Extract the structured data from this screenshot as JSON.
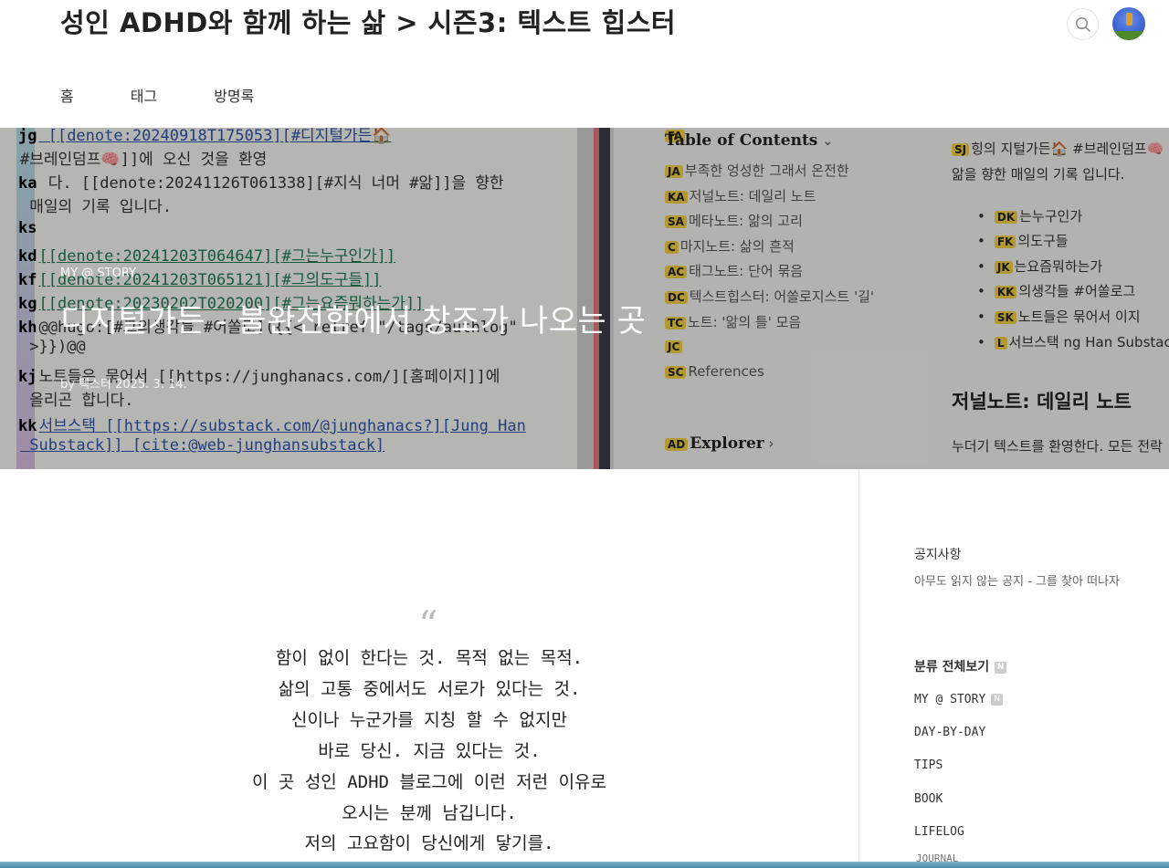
{
  "header": {
    "site_title": "성인 ADHD와 함께 하는 삶 > 시즌3: 텍스트 힙스터",
    "nav": [
      "홈",
      "태그",
      "방명록"
    ]
  },
  "hero": {
    "category": "MY @ STORY",
    "title": "디지털가든 - 불완전함에서 창조가 나오는 곳",
    "meta": "by 텍스터   2025. 3. 14.",
    "code_lines": [
      {
        "tag": "jg",
        "text": " [[denote:20240918T175053][#디지털가든🏠"
      },
      {
        "tag": "",
        "text": "#브레인덤프🧠]]에 오신 것을 환영"
      },
      {
        "tag": "ka",
        "text": " 다. [[denote:20241126T061338][#지식 너머 #앎]]을 향한"
      },
      {
        "tag": "",
        "text": " 매일의 기록 입니다."
      },
      {
        "tag": "ks",
        "text": ""
      },
      {
        "tag": "kd",
        "text": "[[denote:20241203T064647][#그는누구인가]]"
      },
      {
        "tag": "kf",
        "text": "[[denote:20241203T065121][#그의도구들]]"
      },
      {
        "tag": "kg",
        "text": "[[denote:20230202T020200][#그는요즘뭐하는가]]"
      },
      {
        "tag": "kh",
        "text": "@@hugo:[#그의생각들 #어쏠로]({{< relref \"/tags/authlog\""
      },
      {
        "tag": "",
        "text": " >}})@@"
      },
      {
        "tag": "kj",
        "text": "노트들은 묶어서 [[https://junghanacs.com/][홈페이지]]에"
      },
      {
        "tag": "",
        "text": " 올리곤 합니다."
      },
      {
        "tag": "kk",
        "text": "서브스택 [[https://substack.com/@junghanacs?][Jung Han"
      },
      {
        "tag": "",
        "text": " Substack]] [cite:@web-junghansubstack]"
      }
    ],
    "toc_title": "Table of Contents",
    "toc": [
      {
        "hint": "FA",
        "text": ""
      },
      {
        "hint": "JA",
        "text": "부족한 엉성한 그래서 온전한"
      },
      {
        "hint": "KA",
        "text": "저널노트: 데일리 노트"
      },
      {
        "hint": "SA",
        "text": "메타노트: 앎의 고리"
      },
      {
        "hint": "C",
        "text": "마지노트: 삶의 흔적"
      },
      {
        "hint": "AC",
        "text": "태그노트: 단어 묶음"
      },
      {
        "hint": "DC",
        "text": "텍스트힙스터: 어쏠로지스트 '길'"
      },
      {
        "hint": "TC",
        "text": "노트: '앎의 틀' 모음"
      },
      {
        "hint": "JC",
        "text": ""
      },
      {
        "hint": "SC",
        "text": "References"
      }
    ],
    "explorer": "Explorer",
    "explorer_hint": "AD",
    "right_intro_1": "힝의 지털가든🏠 #브레인덤프🧠",
    "right_intro_hint": "SJ",
    "right_intro_2": "앎을 향한 매일의 기록 입니다.",
    "right_bullets": [
      {
        "hint": "DK",
        "text": "는누구인가"
      },
      {
        "hint": "FK",
        "text": "의도구들"
      },
      {
        "hint": "JK",
        "text": "는요즘뭐하는가"
      },
      {
        "hint": "KK",
        "text": "의생각들 #어쏠로그"
      },
      {
        "hint": "SK",
        "text": "노트들은 묶어서 이지"
      },
      {
        "hint": "L",
        "text": "서브스택 ng Han Substack"
      }
    ],
    "right_heading": "저널노트: 데일리 노트",
    "right_para": "누더기 텍스트를 환영한다. 모든 전락"
  },
  "quote": {
    "mark": "“",
    "lines": [
      "함이 없이 한다는 것. 목적 없는 목적.",
      "삶의 고통 중에서도 서로가 있다는 것.",
      "신이나  누군가를 지칭 할 수 없지만",
      "바로 당신. 지금 있다는 것.",
      "이 곳 성인 ADHD 블로그에 이런 저런 이유로",
      "오시는 분께 남깁니다.",
      "저의 고요함이 당신에게 닿기를."
    ]
  },
  "sidebar": {
    "notice_head": "공지사항",
    "notice_text": "아무도 읽지 않는 공지 - 그를 찾아 떠나자",
    "cat_head": "분류 전체보기",
    "new_badge": "N",
    "categories": [
      "MY @ STORY",
      "DAY-BY-DAY",
      "TIPS",
      "BOOK",
      "LIFELOG"
    ],
    "sub_category": "JOURNAL"
  },
  "colors": {
    "hint_yellow": "#f2cf43",
    "link_blue": "#2d55a8",
    "link_green": "#1e7b4e"
  }
}
